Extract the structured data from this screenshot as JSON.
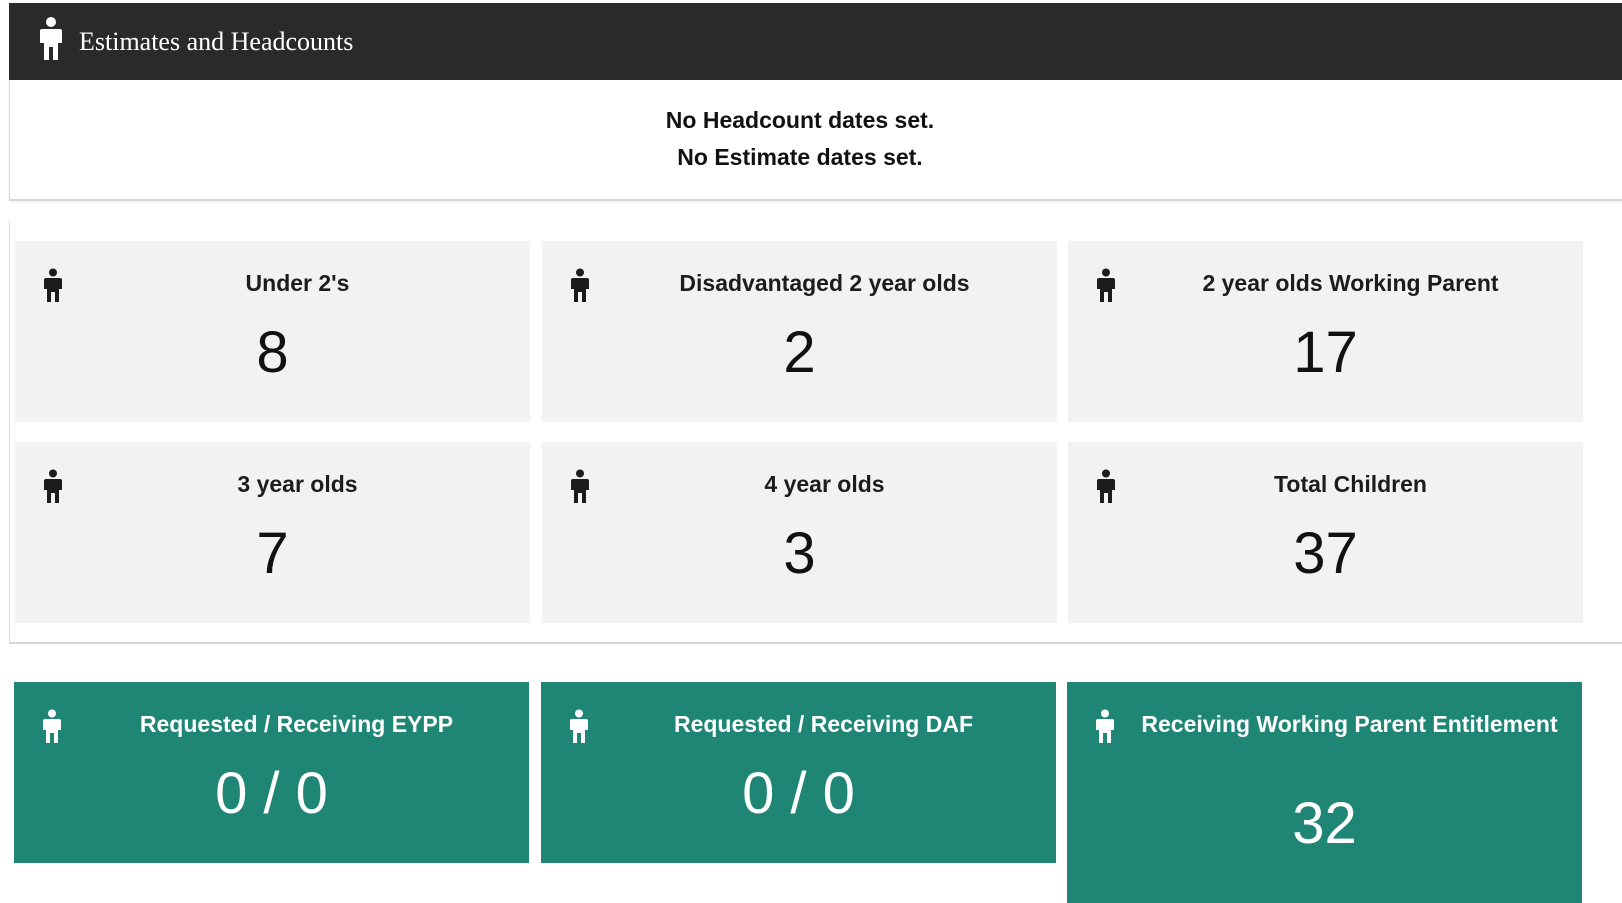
{
  "header": {
    "title": "Estimates and Headcounts",
    "icon": "person-icon"
  },
  "notices": {
    "headcount": "No Headcount dates set.",
    "estimate": "No Estimate dates set."
  },
  "stats": [
    {
      "label": "Under 2's",
      "value": "8",
      "icon": "person-icon"
    },
    {
      "label": "Disadvantaged 2 year olds",
      "value": "2",
      "icon": "person-icon"
    },
    {
      "label": "2 year olds Working Parent",
      "value": "17",
      "icon": "person-icon"
    },
    {
      "label": "3 year olds",
      "value": "7",
      "icon": "person-icon"
    },
    {
      "label": "4 year olds",
      "value": "3",
      "icon": "person-icon"
    },
    {
      "label": "Total Children",
      "value": "37",
      "icon": "person-icon"
    }
  ],
  "funding": [
    {
      "label": "Requested / Receiving EYPP",
      "value": "0 / 0",
      "icon": "person-icon"
    },
    {
      "label": "Requested / Receiving DAF",
      "value": "0 / 0",
      "icon": "person-icon"
    },
    {
      "label": "Receiving Working Parent Entitlement",
      "value": "32",
      "icon": "person-icon"
    }
  ],
  "colors": {
    "header_bg": "#2a2a2a",
    "card_bg": "#f2f2f2",
    "teal": "#1f8676"
  }
}
